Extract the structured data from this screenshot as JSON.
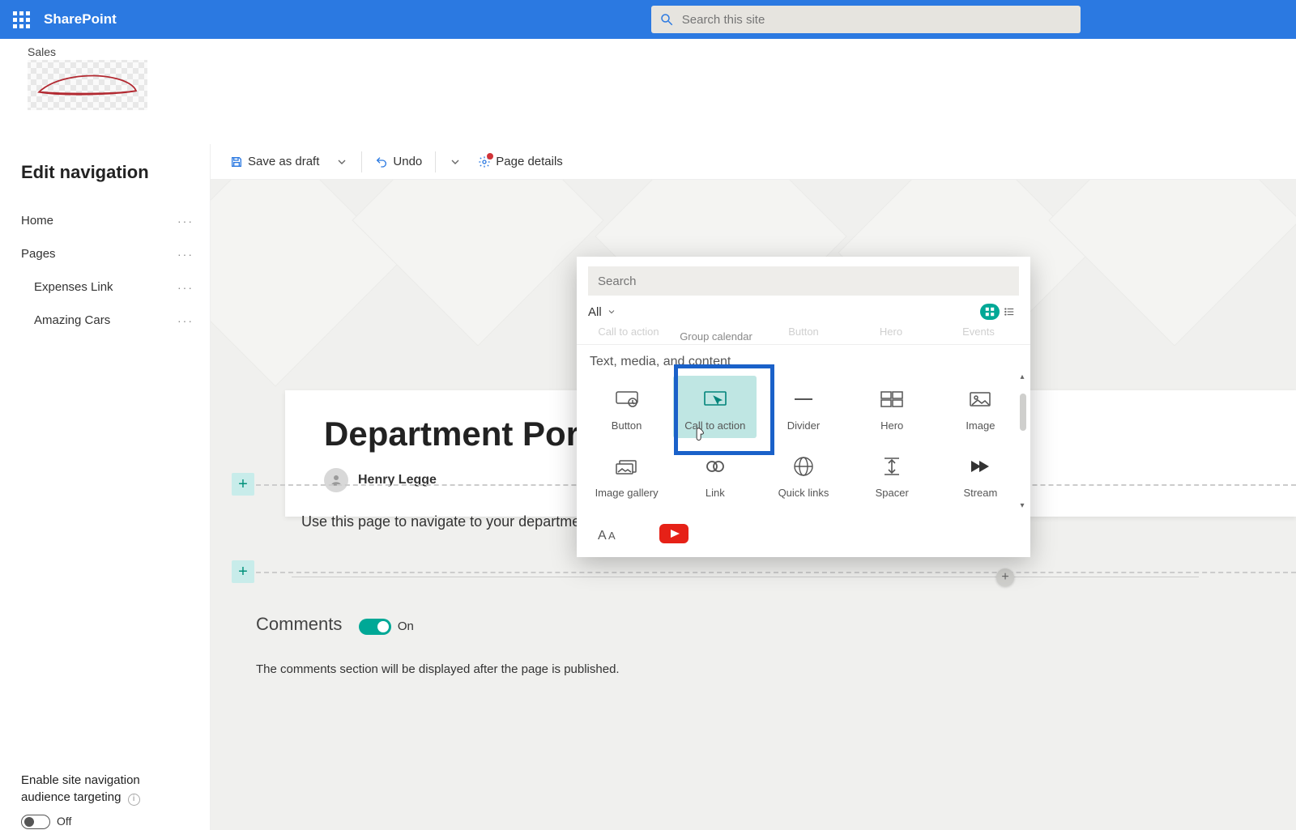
{
  "topbar": {
    "brand": "SharePoint",
    "search_placeholder": "Search this site"
  },
  "site": {
    "name": "Sales"
  },
  "leftnav": {
    "title": "Edit navigation",
    "items": [
      {
        "label": "Home",
        "sub": false
      },
      {
        "label": "Pages",
        "sub": false
      },
      {
        "label": "Expenses Link",
        "sub": true
      },
      {
        "label": "Amazing Cars",
        "sub": true
      }
    ],
    "audience_label_line1": "Enable site navigation",
    "audience_label_line2": "audience targeting",
    "audience_state": "Off"
  },
  "cmdbar": {
    "save_draft": "Save as draft",
    "undo": "Undo",
    "page_details": "Page details"
  },
  "page": {
    "title": "Department Portals",
    "author": "Henry Legge",
    "intro": "Use this page to navigate to your departme",
    "comments_label": "Comments",
    "comments_state": "On",
    "comments_hint": "The comments section will be displayed after the page is published."
  },
  "picker": {
    "search_placeholder": "Search",
    "filter": "All",
    "peek": [
      "Call to action",
      "Group calendar",
      "Button",
      "Hero",
      "Events"
    ],
    "section": "Text, media, and content",
    "row1": [
      "Button",
      "Call to action",
      "Divider",
      "Hero",
      "Image"
    ],
    "row2": [
      "Image gallery",
      "Link",
      "Quick links",
      "Spacer",
      "Stream"
    ]
  }
}
